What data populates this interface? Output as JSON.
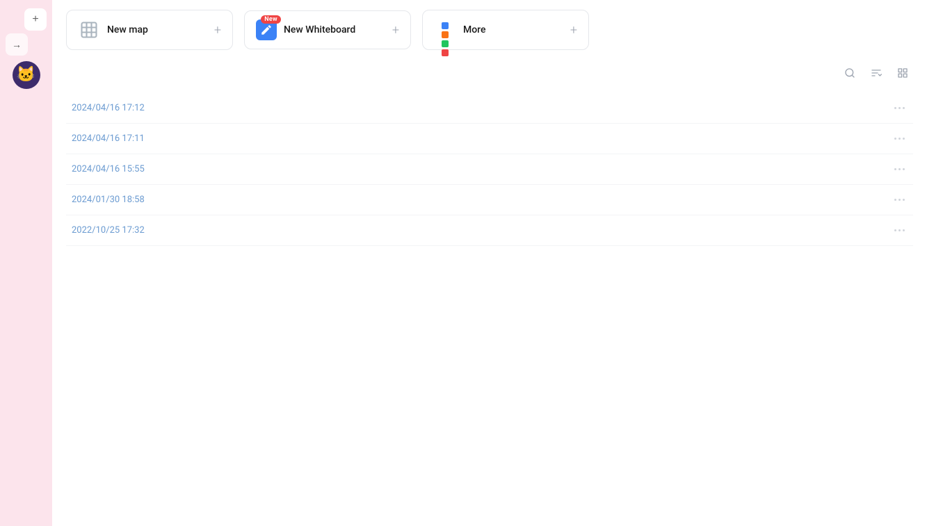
{
  "sidebar": {
    "plus_label": "+",
    "arrow_label": "→",
    "avatar_emoji": "🐱"
  },
  "cards": [
    {
      "id": "new-map",
      "label": "New map",
      "icon_type": "map",
      "plus_label": "+",
      "has_new_badge": false
    },
    {
      "id": "new-whiteboard",
      "label": "New Whiteboard",
      "icon_type": "whiteboard",
      "plus_label": "+",
      "has_new_badge": true,
      "new_badge_text": "New"
    },
    {
      "id": "more",
      "label": "More",
      "icon_type": "more",
      "plus_label": "+",
      "has_new_badge": false
    }
  ],
  "toolbar": {
    "search_icon": "search",
    "sort_icon": "sort",
    "view_icon": "view"
  },
  "list": {
    "items": [
      {
        "date": "2024/04/16 17:12"
      },
      {
        "date": "2024/04/16 17:11"
      },
      {
        "date": "2024/04/16 15:55"
      },
      {
        "date": "2024/01/30 18:58"
      },
      {
        "date": "2022/10/25 17:32"
      }
    ]
  }
}
